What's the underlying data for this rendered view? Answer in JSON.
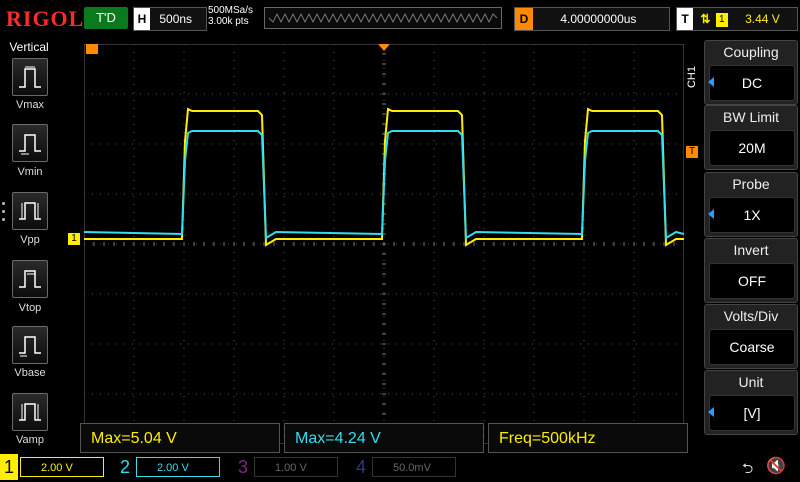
{
  "header": {
    "brand": "RIGOL",
    "run_state": "T'D",
    "horizontal": {
      "label": "H",
      "timebase": "500ns"
    },
    "sample_rate": "500MSa/s",
    "memory_depth": "3.00k pts",
    "delay": {
      "label": "D",
      "value": "4.00000000us"
    },
    "trigger": {
      "label": "T",
      "source": "1",
      "level": "3.44 V"
    }
  },
  "left_menu": {
    "title": "Vertical",
    "items": [
      {
        "label": "Vmax",
        "icon": "vmax-icon"
      },
      {
        "label": "Vmin",
        "icon": "vmin-icon"
      },
      {
        "label": "Vpp",
        "icon": "vpp-icon"
      },
      {
        "label": "Vtop",
        "icon": "vtop-icon"
      },
      {
        "label": "Vbase",
        "icon": "vbase-icon"
      },
      {
        "label": "Vamp",
        "icon": "vamp-icon"
      }
    ]
  },
  "right_menu": {
    "channel_tag": "CH1",
    "items": [
      {
        "title": "Coupling",
        "value": "DC"
      },
      {
        "title": "BW Limit",
        "value": "20M"
      },
      {
        "title": "Probe",
        "value": "1X"
      },
      {
        "title": "Invert",
        "value": "OFF"
      },
      {
        "title": "Volts/Div",
        "value": "Coarse"
      },
      {
        "title": "Unit",
        "value": "[V]"
      }
    ]
  },
  "measurements": [
    {
      "text": "Max=5.04 V",
      "color": "#ffee00"
    },
    {
      "text": "Max=4.24 V",
      "color": "#33ddee"
    },
    {
      "text": "Freq=500kHz",
      "color": "#ffee00"
    }
  ],
  "channels": [
    {
      "num": "1",
      "scale": "2.00 V",
      "color": "#ffee00",
      "active": true
    },
    {
      "num": "2",
      "scale": "2.00 V",
      "color": "#33ddee",
      "active": true
    },
    {
      "num": "3",
      "scale": "1.00 V",
      "color": "#ff00ff",
      "active": false
    },
    {
      "num": "4",
      "scale": "50.0mV",
      "color": "#2266ff",
      "active": false
    }
  ],
  "markers": {
    "ch1_ground": "1",
    "trigger_marker": "T"
  },
  "colors": {
    "ch1": "#ffee00",
    "ch2": "#33ddee",
    "accent": "#ff8a00",
    "run": "#0b7a1c",
    "brand": "#ff2a2a"
  }
}
